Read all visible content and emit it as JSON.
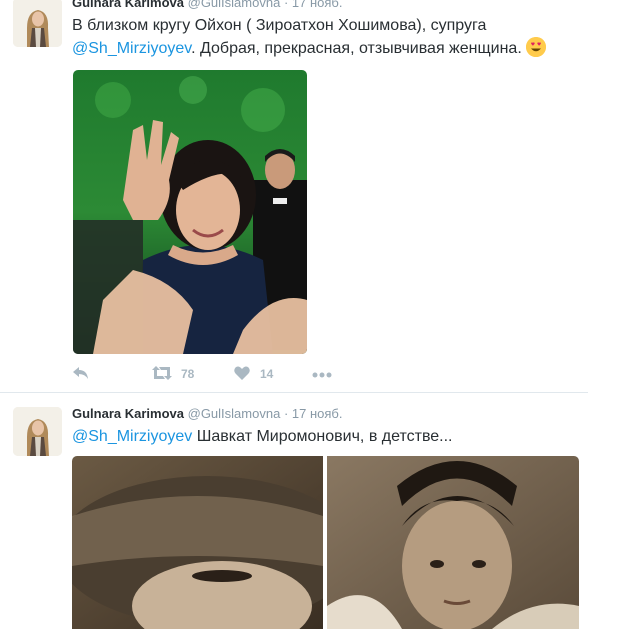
{
  "tweets": [
    {
      "author_name": "Gulnara Karimova",
      "handle": "@GulIslamovna",
      "separator": "·",
      "date": "17 нояб.",
      "text_before": "В близком кругу Ойхон ( Зироатхон Хошимова), супруга",
      "mention": "@Sh_Mirziyoyev",
      "text_after": ". Добрая, прекрасная, отзывчивая женщина.",
      "emoji": "heart-eyes-emoji",
      "actions": {
        "retweets": "78",
        "likes": "14"
      }
    },
    {
      "author_name": "Gulnara Karimova",
      "handle": "@GulIslamovna",
      "separator": "·",
      "date": "17 нояб.",
      "mention": "@Sh_Mirziyoyev",
      "text_after": " Шавкат Миромонович, в детстве..."
    }
  ],
  "colors": {
    "link": "#1b95e0",
    "meta": "#8899a6",
    "action_icon": "#aab8c2",
    "divider": "#e1e8ed"
  },
  "icons": [
    "reply-icon",
    "retweet-icon",
    "like-icon",
    "more-icon"
  ]
}
